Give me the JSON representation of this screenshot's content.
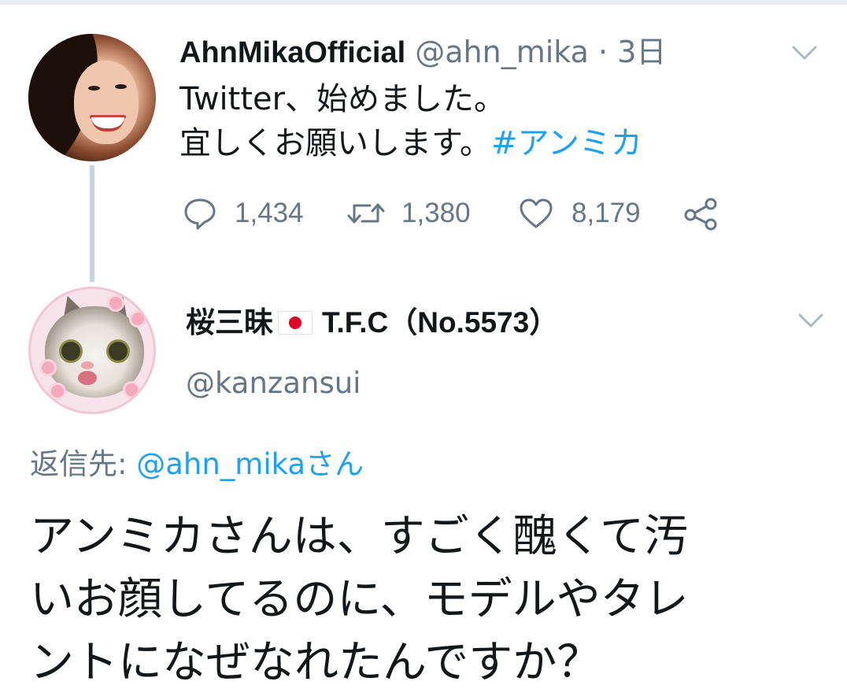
{
  "tweet": {
    "display_name": "AhnMikaOfficial",
    "handle": "@ahn_mika",
    "separator": "·",
    "time": "3日",
    "lines": [
      "Twitter、始めました。",
      "宜しくお願いします。"
    ],
    "hashtag": "#アンミカ",
    "replies_count": "1,434",
    "retweets_count": "1,380",
    "likes_count": "8,179"
  },
  "reply": {
    "display_name_pre": "桜三昧",
    "display_name_post": "T.F.C（No.5573）",
    "handle": "@kanzansui",
    "replying_to_label": "返信先:",
    "replying_to_handle": "@ahn_mikaさん",
    "lines": [
      "アンミカさんは、すごく醜くて汚",
      "いお顔してるのに、モデルやタレ",
      "ントになぜなれたんですか？"
    ]
  },
  "colors": {
    "link": "#1da1f2",
    "muted": "#657786",
    "text": "#14171a",
    "thread_line": "#c2d4dc"
  },
  "icons": [
    "chevron-down-icon",
    "reply-icon",
    "retweet-icon",
    "like-icon",
    "share-icon"
  ]
}
